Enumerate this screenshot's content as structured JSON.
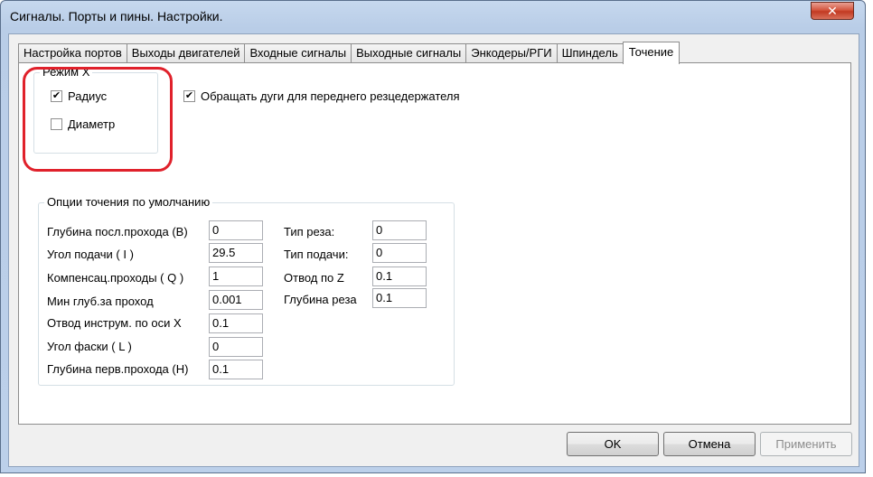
{
  "window": {
    "title": "Сигналы. Порты и пины. Настройки.",
    "close_label": "✕"
  },
  "tabs": [
    {
      "label": "Настройка портов"
    },
    {
      "label": "Выходы двигателей"
    },
    {
      "label": "Входные сигналы"
    },
    {
      "label": "Выходные сигналы"
    },
    {
      "label": "Энкодеры/РГИ"
    },
    {
      "label": "Шпиндель"
    },
    {
      "label": "Точение",
      "active": true
    }
  ],
  "x_mode": {
    "legend": "Режим X",
    "radius": {
      "label": "Радиус",
      "checked": true,
      "mark": "✔"
    },
    "diameter": {
      "label": "Диаметр",
      "checked": false,
      "mark": ""
    }
  },
  "reverse_arcs": {
    "label": "Обращать дуги для переднего резцедержателя",
    "checked": true,
    "mark": "✔"
  },
  "turning_defaults": {
    "legend": "Опции точения по умолчанию",
    "left": [
      {
        "label": "Глубина посл.прохода (В)",
        "value": "0"
      },
      {
        "label": "Угол подачи ( I )",
        "value": "29.5"
      },
      {
        "label": "Компенсац.проходы ( Q )",
        "value": "1"
      },
      {
        "label": "Мин глуб.за проход",
        "value": "0.001"
      },
      {
        "label": "Отвод инструм. по оси X",
        "value": "0.1"
      },
      {
        "label": "Угол фаски ( L )",
        "value": "0"
      },
      {
        "label": "Глубина перв.прохода (H)",
        "value": "0.1"
      }
    ],
    "right": [
      {
        "label": "Тип реза:",
        "value": "0"
      },
      {
        "label": "Тип подачи:",
        "value": "0"
      },
      {
        "label": "Отвод по Z",
        "value": "0.1"
      },
      {
        "label": "Глубина реза",
        "value": "0.1"
      }
    ]
  },
  "buttons": {
    "ok": "OK",
    "cancel": "Отмена",
    "apply": "Применить"
  }
}
